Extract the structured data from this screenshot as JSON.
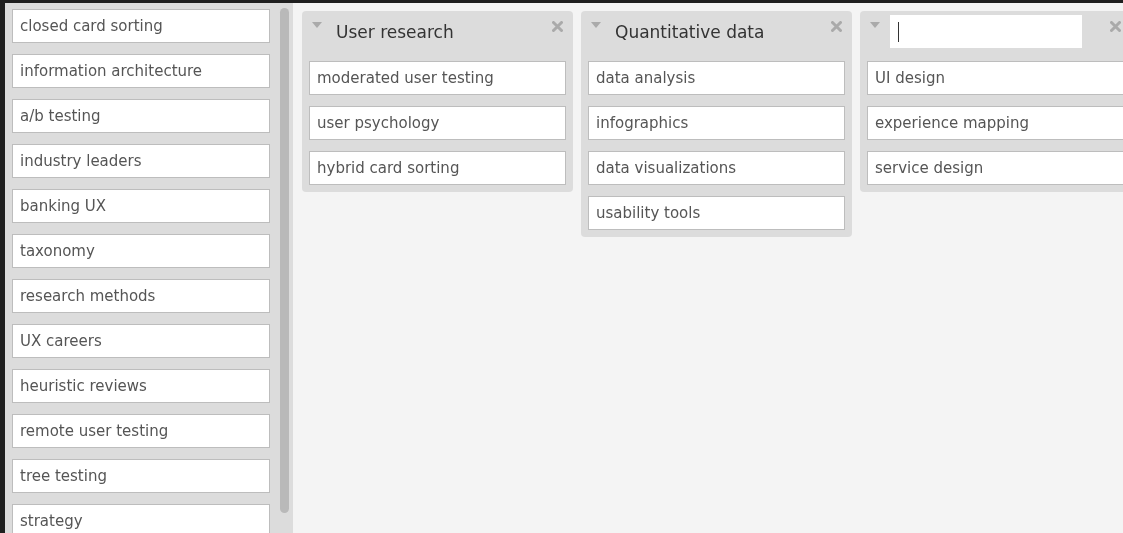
{
  "sidebar": {
    "cards": [
      {
        "label": "closed card sorting"
      },
      {
        "label": "information architecture"
      },
      {
        "label": "a/b testing"
      },
      {
        "label": "industry leaders"
      },
      {
        "label": "banking UX"
      },
      {
        "label": "taxonomy"
      },
      {
        "label": "research methods"
      },
      {
        "label": "UX careers"
      },
      {
        "label": "heuristic reviews"
      },
      {
        "label": "remote user testing"
      },
      {
        "label": "tree testing"
      },
      {
        "label": "strategy"
      }
    ]
  },
  "groups": [
    {
      "kind": "titled",
      "title": "User research",
      "cards": [
        "moderated user testing",
        "user psychology",
        "hybrid card sorting"
      ]
    },
    {
      "kind": "titled",
      "title": "Quantitative data",
      "cards": [
        "data analysis",
        "infographics",
        "data visualizations",
        "usability tools"
      ]
    },
    {
      "kind": "editing",
      "cards": [
        "UI design",
        "experience mapping",
        "service design"
      ]
    }
  ]
}
